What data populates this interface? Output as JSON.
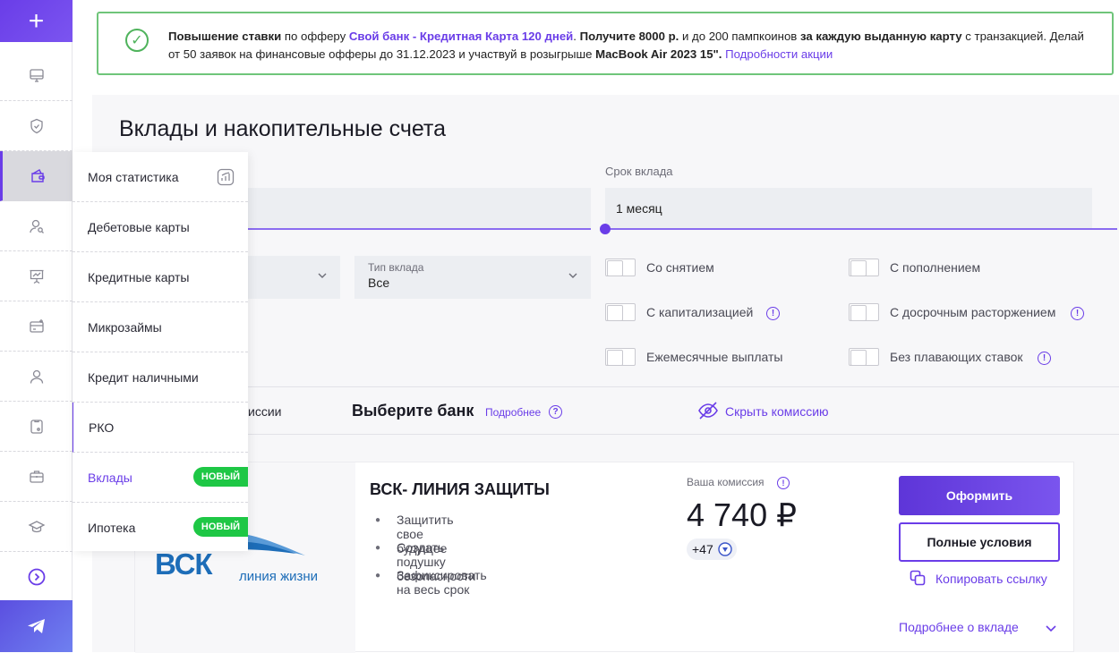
{
  "sidebar": {
    "add_label": "+",
    "icons": [
      "monitor-icon",
      "shield-check-icon",
      "wallet-icon",
      "user-search-icon",
      "presentation-icon",
      "card-add-icon",
      "user-icon",
      "phone-card-icon",
      "briefcase-icon",
      "graduation-cap-icon",
      "arrow-circle-right-icon"
    ],
    "telegram_icon": "telegram-icon"
  },
  "banner": {
    "p1": "Повышение ставки",
    "p2": " по офферу ",
    "offer_link": "Свой банк - Кредитная Карта 120 дней",
    "p3": ". ",
    "p4": "Получите 8000 р.",
    "p5": " и до 200 пампкоинов ",
    "p6": "за каждую выданную карту",
    "p7": " с транзакцией. Делай от 50 заявок на финансовые офферы до 31.12.2023 и участвуй в розыгрыше ",
    "p8": "MacBook Air 2023 15\".",
    "p9": " ",
    "promo_link": "Подробности акции"
  },
  "main": {
    "title": "Вклады и накопительные счета",
    "term_label": "Срок вклада",
    "term_value": "1 месяц",
    "type_select": {
      "label": "Тип вклада",
      "value": "Все"
    },
    "toggles": [
      "Со снятием",
      "С пополнением",
      "С капитализацией",
      "С досрочным расторжением",
      "Ежемесячные выплаты",
      "Без плавающих ставок"
    ],
    "commission_partial": "иссии",
    "choose_bank": "Выберите банк",
    "more_link": "Подробнее",
    "hide_commission": "Скрыть комиссию"
  },
  "card": {
    "title": "ВСК- ЛИНИЯ ЗАЩИТЫ",
    "bullets": [
      "Защитить свое будущее",
      "Создать подушку безопасности",
      "Зафиксировать на весь срок"
    ],
    "commission_label": "Ваша комиссия",
    "commission_value": "4 740 ₽",
    "coins": "+47",
    "apply_btn": "Оформить",
    "terms_btn": "Полные условия",
    "copy_link": "Копировать ссылку",
    "details_link": "Подробнее о вкладе",
    "logo_text": "ВСК",
    "logo_sub": "линия жизни"
  },
  "flyout": {
    "items": [
      {
        "label": "Моя статистика"
      },
      {
        "label": "Дебетовые карты"
      },
      {
        "label": "Кредитные карты"
      },
      {
        "label": "Микрозаймы"
      },
      {
        "label": "Кредит наличными"
      },
      {
        "label": "РКО"
      },
      {
        "label": "Вклады",
        "badge": "НОВЫЙ"
      },
      {
        "label": "Ипотека",
        "badge": "НОВЫЙ"
      }
    ]
  },
  "colors": {
    "accent": "#6a3de8",
    "success": "#1ec745",
    "banner_border": "#6fc57a"
  }
}
